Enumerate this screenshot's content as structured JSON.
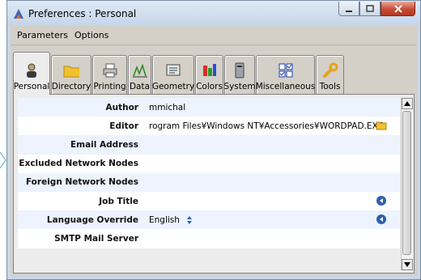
{
  "window": {
    "title": "Preferences : Personal",
    "buttons": [
      "minimize",
      "maximize",
      "close"
    ]
  },
  "menu": [
    "Parameters",
    "Options"
  ],
  "tabs": [
    {
      "label": "Personal",
      "icon": "person-icon",
      "active": true
    },
    {
      "label": "Directory",
      "icon": "folder-icon"
    },
    {
      "label": "Printing",
      "icon": "printer-icon"
    },
    {
      "label": "Data",
      "icon": "data-chart-icon"
    },
    {
      "label": "Geometry",
      "icon": "geometry-icon"
    },
    {
      "label": "Colors",
      "icon": "colors-icon"
    },
    {
      "label": "System",
      "icon": "system-icon"
    },
    {
      "label": "Miscellaneous",
      "icon": "checkbox-grid-icon"
    },
    {
      "label": "Tools",
      "icon": "wrench-icon"
    }
  ],
  "fields": [
    {
      "label": "Author",
      "value": "mmichal"
    },
    {
      "label": "Editor",
      "value": "rogram Files¥Windows NT¥Accessories¥WORDPAD.EXE",
      "trailing_icon": "folder-icon"
    },
    {
      "label": "Email Address",
      "value": ""
    },
    {
      "label": "Excluded Network Nodes",
      "value": ""
    },
    {
      "label": "Foreign Network Nodes",
      "value": ""
    },
    {
      "label": "Job Title",
      "value": "",
      "trailing_icon": "reset-icon"
    },
    {
      "label": "Language Override",
      "value": "English",
      "value_icon": "spinner-icon",
      "trailing_icon": "reset-icon"
    },
    {
      "label": "SMTP Mail Server",
      "value": ""
    }
  ],
  "colors": {
    "row_alt": "#edf3ff",
    "row_plain": "#ffffff",
    "tab_bg": "#d4d0c8"
  }
}
